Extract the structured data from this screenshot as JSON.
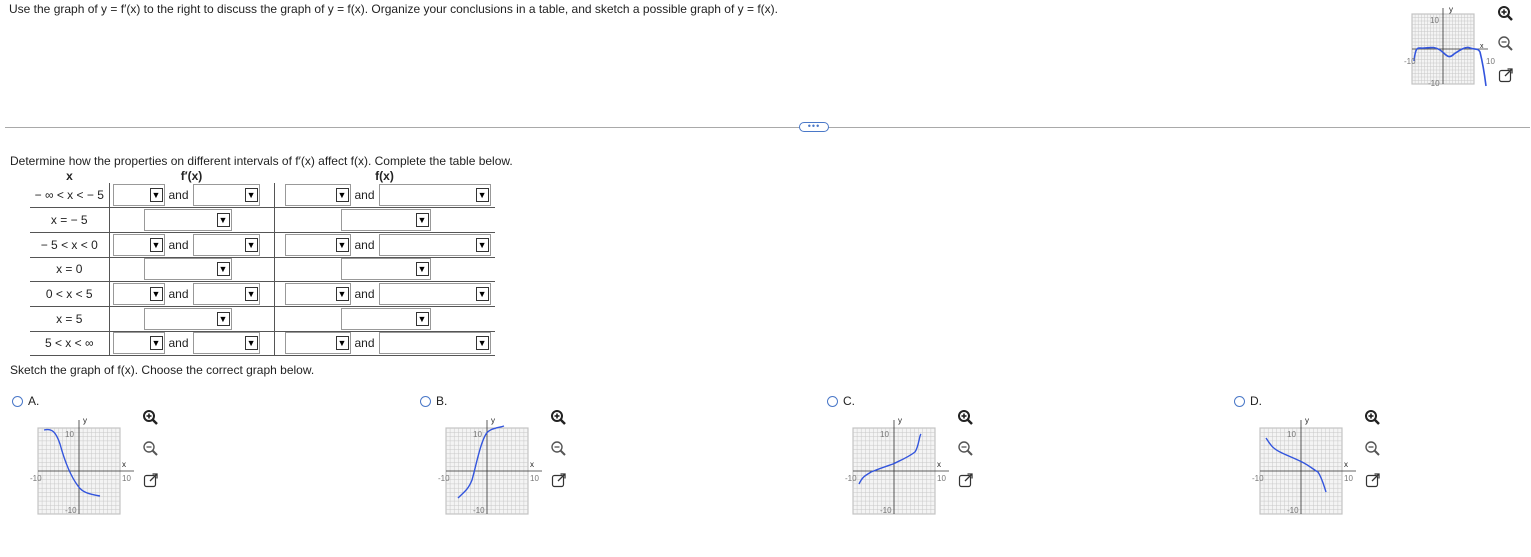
{
  "question": {
    "text": "Use the graph of y = f′(x) to the right to discuss the graph of y = f(x). Organize your conclusions in a table, and sketch a possible graph of y = f(x)."
  },
  "expand_button": {
    "label": "•••"
  },
  "table_instruction": "Determine how the properties on different intervals of f′(x) affect f(x). Complete the table below.",
  "table": {
    "headers": {
      "x": "x",
      "fprime": "f′(x)",
      "f": "f(x)"
    },
    "and_label": "and",
    "rows": [
      {
        "x": "− ∞ < x < − 5",
        "type": "interval"
      },
      {
        "x": "x = − 5",
        "type": "point"
      },
      {
        "x": "− 5 < x < 0",
        "type": "interval"
      },
      {
        "x": "x = 0",
        "type": "point"
      },
      {
        "x": "0 < x < 5",
        "type": "interval"
      },
      {
        "x": "x = 5",
        "type": "point"
      },
      {
        "x": "5 < x < ∞",
        "type": "interval"
      }
    ]
  },
  "sketch_instruction": "Sketch the graph of f(x). Choose the correct graph below.",
  "options": [
    {
      "label": "A."
    },
    {
      "label": "B."
    },
    {
      "label": "C."
    },
    {
      "label": "D."
    }
  ],
  "graph_labels": {
    "y": "y",
    "x": "x",
    "top": "10",
    "bottom": "-10",
    "left": "-10",
    "right": "10"
  },
  "icons": {
    "zoom_in": "zoom-in-icon",
    "zoom_out": "zoom-out-icon",
    "popout": "popout-icon"
  },
  "colors": {
    "accent": "#4a78c8",
    "curve": "#3355dd",
    "grid": "#c8c8c8"
  }
}
